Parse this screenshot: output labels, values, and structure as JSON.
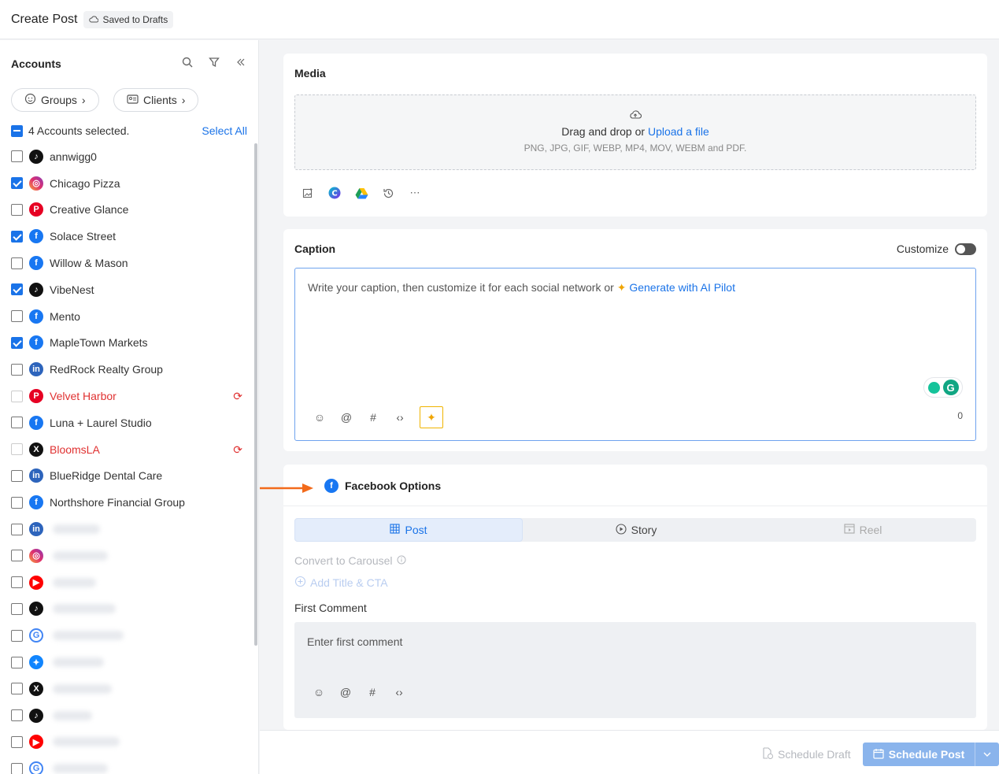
{
  "header": {
    "title": "Create Post",
    "saved_label": "Saved to Drafts"
  },
  "sidebar": {
    "title": "Accounts",
    "groups_label": "Groups",
    "clients_label": "Clients",
    "selected_text": "4 Accounts selected.",
    "select_all": "Select All",
    "accounts": [
      {
        "name": "annwigg0",
        "network": "tiktok-icon",
        "checked": false
      },
      {
        "name": "Chicago Pizza",
        "network": "instagram-icon",
        "checked": true
      },
      {
        "name": "Creative Glance",
        "network": "pinterest-icon",
        "checked": false
      },
      {
        "name": "Solace Street",
        "network": "facebook-icon",
        "checked": true
      },
      {
        "name": "Willow & Mason",
        "network": "facebook-icon",
        "checked": false
      },
      {
        "name": "VibeNest",
        "network": "tiktok-icon",
        "checked": true
      },
      {
        "name": "Mento",
        "network": "facebook-icon",
        "checked": false
      },
      {
        "name": "MapleTown Markets",
        "network": "facebook-icon",
        "checked": true
      },
      {
        "name": "RedRock Realty Group",
        "network": "linkedin-icon",
        "checked": false
      },
      {
        "name": "Velvet Harbor",
        "network": "pinterest-icon",
        "checked": false,
        "error": true
      },
      {
        "name": "Luna + Laurel Studio",
        "network": "facebook-icon",
        "checked": false
      },
      {
        "name": "BloomsLA",
        "network": "x-icon",
        "checked": false,
        "error": true
      },
      {
        "name": "BlueRidge Dental Care",
        "network": "linkedin-icon",
        "checked": false
      },
      {
        "name": "Northshore Financial Group",
        "network": "facebook-icon",
        "checked": false
      }
    ],
    "blurred_accounts": [
      "linkedin-icon",
      "instagram-icon",
      "youtube-icon",
      "tiktok-icon",
      "google-icon",
      "bluesky-icon",
      "x-icon",
      "tiktok-icon",
      "youtube-icon",
      "google-icon"
    ]
  },
  "media": {
    "title": "Media",
    "drop_text": "Drag and drop or",
    "upload_link": "Upload a file",
    "formats": "PNG, JPG, GIF, WEBP, MP4, MOV, WEBM and PDF."
  },
  "caption": {
    "title": "Caption",
    "customize_label": "Customize",
    "placeholder": "Write your caption, then customize it for each social network or",
    "ai_link": "Generate with AI Pilot",
    "char_count": "0"
  },
  "facebook": {
    "title": "Facebook Options",
    "tabs": [
      "Post",
      "Story",
      "Reel"
    ],
    "convert_carousel": "Convert to Carousel",
    "add_title_cta": "Add Title & CTA",
    "first_comment_label": "First Comment",
    "first_comment_placeholder": "Enter first comment"
  },
  "footer": {
    "schedule_draft": "Schedule Draft",
    "schedule_post": "Schedule Post"
  },
  "colors": {
    "accent": "#1a73e8",
    "error": "#e03131",
    "arrow": "#f26a1b"
  }
}
